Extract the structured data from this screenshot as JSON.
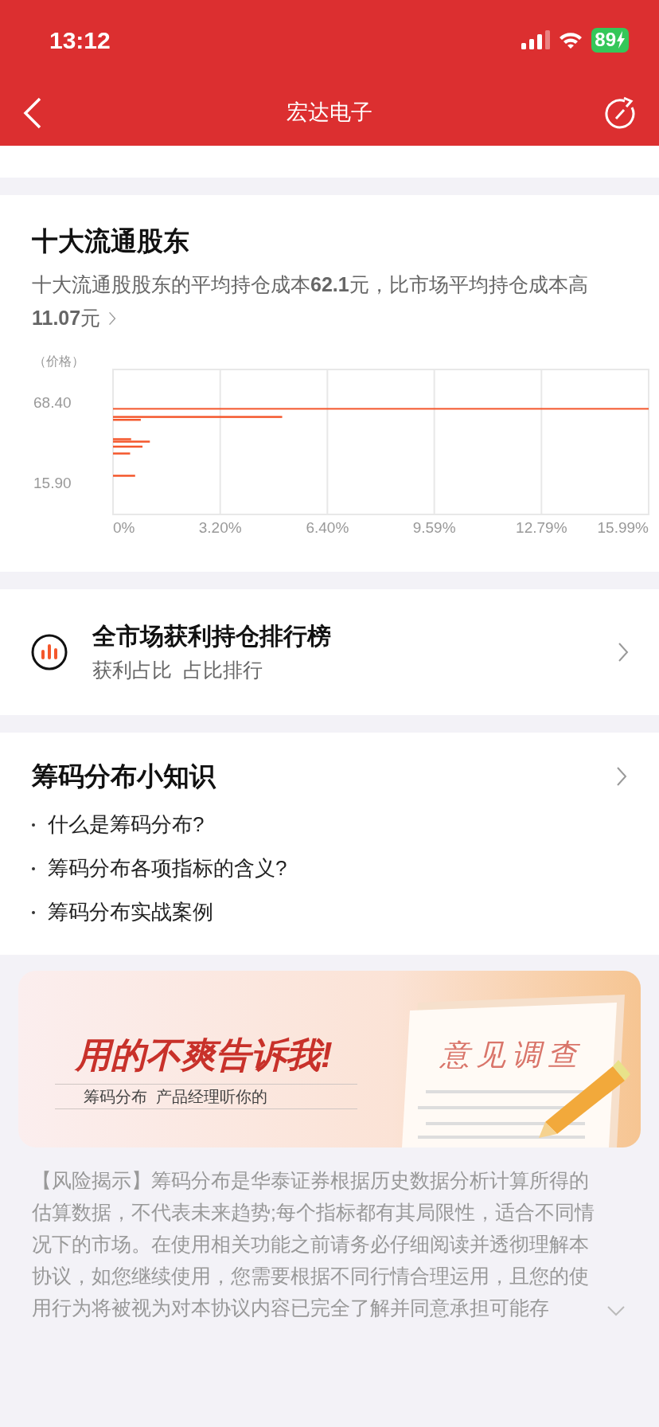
{
  "status_bar": {
    "time": "13:12",
    "battery": "89"
  },
  "nav": {
    "title": "宏达电子"
  },
  "holders": {
    "title": "十大流通股东",
    "summary": "十大流通股股东的平均持仓成本**62.1**元，比市场平均持仓成本高**11.07**元",
    "chart_data": {
      "type": "bar",
      "orientation": "horizontal",
      "ylabel": "（价格）",
      "x": [
        59.5,
        57.6,
        44.9,
        43.3,
        40.0,
        35.5,
        20.9
      ],
      "series": [
        {
          "color": "#f4572c",
          "values": [
            5.05,
            0.83,
            0.54,
            1.1,
            0.88,
            0.51,
            0.66
          ]
        }
      ],
      "grid": true,
      "xlim": [
        0,
        15.99
      ],
      "ylim": [
        -4.6,
        90.5
      ],
      "xticks": [
        {
          "value": 0,
          "label": "0%"
        },
        {
          "value": 3.2,
          "label": "3.20%"
        },
        {
          "value": 6.4,
          "label": "6.40%"
        },
        {
          "value": 9.59,
          "label": "9.59%"
        },
        {
          "value": 12.79,
          "label": "12.79%"
        },
        {
          "value": 15.99,
          "label": "15.99%"
        }
      ],
      "yticks": [
        {
          "value": 68.4,
          "label": "68.40"
        },
        {
          "value": 15.9,
          "label": "15.90"
        }
      ],
      "ref_lines": [
        {
          "axis": "y",
          "value": 64.7
        }
      ]
    }
  },
  "ranking": {
    "title": "全市场获利持仓排行榜",
    "subtitle": "获利占比  占比排行"
  },
  "knowledge": {
    "title": "筹码分布小知识",
    "items": [
      "什么是筹码分布?",
      "筹码分布各项指标的含义?",
      "筹码分布实战案例"
    ]
  },
  "banner": {
    "headline": "用的不爽告诉我!",
    "tagline": "筹码分布  产品经理听你的",
    "survey": "意见调查"
  },
  "risk_notice": "【风险揭示】筹码分布是华泰证券根据历史数据分析计算所得的估算数据，不代表未来趋势;每个指标都有其局限性，适合不同情况下的市场。在使用相关功能之前请务必仔细阅读并透彻理解本协议，如您继续使用，您需要根据不同行情合理运用，且您的使用行为将被视为对本协议内容已完全了解并同意承担可能存"
}
